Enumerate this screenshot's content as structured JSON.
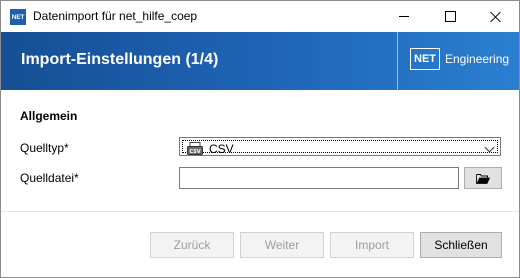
{
  "window": {
    "icon_label": "NET",
    "title": "Datenimport für  net_hilfe_coep"
  },
  "header": {
    "title": "Import-Einstellungen (1/4)",
    "logo_mark": "NET",
    "logo_text": "Engineering"
  },
  "form": {
    "section_title": "Allgemein",
    "source_type_label": "Quelltyp*",
    "source_type_value": "CSV",
    "source_file_label": "Quelldatei*",
    "source_file_value": ""
  },
  "buttons": {
    "back": "Zurück",
    "next": "Weiter",
    "import": "Import",
    "close": "Schließen"
  },
  "colors": {
    "header_start": "#154f93",
    "header_end": "#2b7fd0",
    "disabled_text": "#9d9d9d"
  }
}
